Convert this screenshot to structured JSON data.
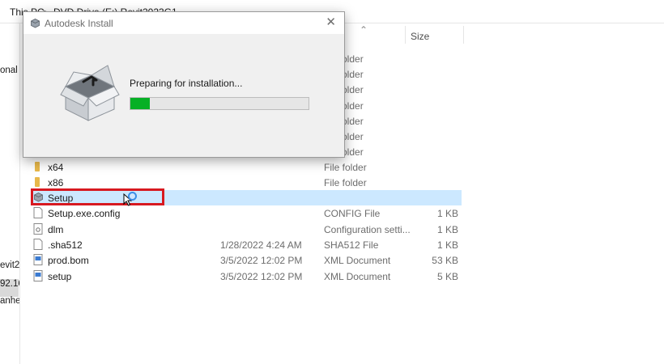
{
  "breadcrumb": {
    "items": [
      "This PC",
      "DVD Drive (E:) Revit2023G1"
    ],
    "separator": ">"
  },
  "nav_pane": {
    "items": [
      "onal",
      "evit2",
      "92.16",
      "anhe"
    ]
  },
  "columns": {
    "size": "Size"
  },
  "background_rows": [
    {
      "type": "older"
    },
    {
      "type": "older"
    },
    {
      "type": "older"
    },
    {
      "type": "older"
    },
    {
      "type": "older"
    },
    {
      "type": "older"
    },
    {
      "type": "older"
    }
  ],
  "files": [
    {
      "name": "x64",
      "date": "",
      "type": "File folder",
      "size": "",
      "icon": "folder-icon"
    },
    {
      "name": "x86",
      "date": "",
      "type": "File folder",
      "size": "",
      "icon": "folder-icon"
    },
    {
      "name": "Setup",
      "date": "",
      "type": "",
      "size": "",
      "icon": "installer-icon",
      "selected": true
    },
    {
      "name": "Setup.exe.config",
      "date": "",
      "type": "CONFIG File",
      "size": "1 KB",
      "icon": "file-icon"
    },
    {
      "name": "dlm",
      "date": "",
      "type": "Configuration setti...",
      "size": "1 KB",
      "icon": "config-file-icon"
    },
    {
      "name": ".sha512",
      "date": "1/28/2022 4:24 AM",
      "type": "SHA512 File",
      "size": "1 KB",
      "icon": "file-icon"
    },
    {
      "name": "prod.bom",
      "date": "3/5/2022 12:02 PM",
      "type": "XML Document",
      "size": "53 KB",
      "icon": "xml-file-icon"
    },
    {
      "name": "setup",
      "date": "3/5/2022 12:02 PM",
      "type": "XML Document",
      "size": "5 KB",
      "icon": "xml-file-icon"
    }
  ],
  "dialog": {
    "title": "Autodesk Install",
    "close_glyph": "✕",
    "message": "Preparing for installation...",
    "progress": 0.11,
    "icon": "software-box-icon"
  },
  "colors": {
    "progress_fill": "#06b025",
    "selection": "#cce8ff",
    "highlight_box": "#d71920",
    "folder": "#e8b84a"
  }
}
